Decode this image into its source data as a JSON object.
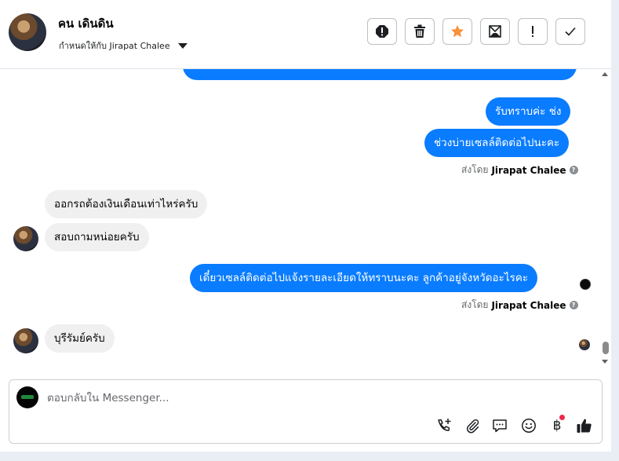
{
  "header": {
    "contact_name": "คน เดินดิน",
    "assigned_label": "กำหนดให้กับ Jirapat Chalee",
    "actions": [
      {
        "name": "spam-button",
        "icon": "alert-circle-icon"
      },
      {
        "name": "delete-button",
        "icon": "trash-icon"
      },
      {
        "name": "star-button",
        "icon": "star-icon"
      },
      {
        "name": "mark-unread-button",
        "icon": "envelope-icon"
      },
      {
        "name": "follow-up-button",
        "icon": "exclamation-icon"
      },
      {
        "name": "done-button",
        "icon": "check-icon"
      }
    ]
  },
  "colors": {
    "outgoing_bubble": "#0a7cff",
    "incoming_bubble": "#f0f0f0",
    "star": "#f7923a",
    "notification_dot": "#f02849"
  },
  "messages": {
    "out_1": "รับทราบค่ะ ช่ง",
    "out_2": "ช่วงบ่ายเซลล์ติดต่อไปนะคะ",
    "in_1": "ออกรถต้องเงินเดือนเท่าไหร่ครับ",
    "in_2": "สอบถามหน่อยครับ",
    "out_3": "เดี๋ยวเซลล์ติดต่อไปแจ้งรายละเอียดให้ทราบนะคะ ลูกค้าอยู่จังหวัดอะไรคะ",
    "in_3": "บุรีรัมย์ครับ"
  },
  "sent_by": {
    "prefix": "ส่งโดย",
    "agent": "Jirapat Chalee",
    "help_glyph": "?"
  },
  "composer": {
    "placeholder": "ตอบกลับใน Messenger...",
    "value": "",
    "tools": [
      {
        "name": "call-add-icon"
      },
      {
        "name": "attachment-icon"
      },
      {
        "name": "saved-reply-icon"
      },
      {
        "name": "emoji-icon"
      },
      {
        "name": "baht-payment-icon",
        "glyph": "฿"
      },
      {
        "name": "like-icon"
      }
    ]
  }
}
